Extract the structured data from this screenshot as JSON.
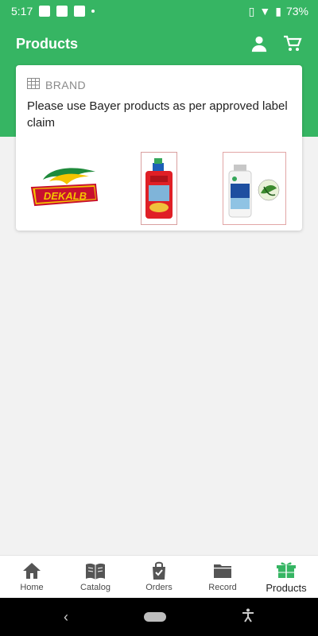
{
  "status": {
    "time": "5:17",
    "battery": "73%"
  },
  "app_bar": {
    "title": "Products"
  },
  "card": {
    "header": "BRAND",
    "message": "Please use Bayer products as per approved label claim",
    "brands": [
      "DEKALB"
    ]
  },
  "bottom_nav": {
    "items": [
      {
        "label": "Home"
      },
      {
        "label": "Catalog"
      },
      {
        "label": "Orders"
      },
      {
        "label": "Record"
      },
      {
        "label": "Products"
      }
    ]
  },
  "colors": {
    "primary": "#36b563",
    "active_icon": "#36b563"
  }
}
